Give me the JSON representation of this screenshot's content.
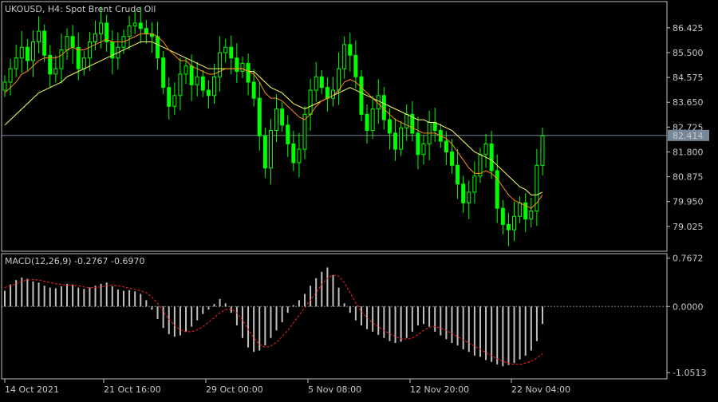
{
  "chart_data": {
    "type": "candlestick",
    "title": "UKOUSD, H4:  Spot Brent Crude Oil",
    "price_panel": {
      "ylim": [
        78.1,
        87.4
      ],
      "yticks": [
        "86.425",
        "85.500",
        "84.575",
        "83.650",
        "82.725",
        "81.800",
        "80.875",
        "79.950",
        "79.025"
      ],
      "current_price": "82.414",
      "series": {
        "close": [
          84.4,
          84.9,
          85.3,
          85.7,
          85.2,
          85.9,
          86.3,
          85.4,
          84.7,
          84.9,
          85.6,
          86.1,
          85.7,
          84.9,
          85.3,
          85.9,
          86.2,
          86.6,
          85.9,
          85.3,
          85.7,
          86.1,
          86.5,
          86.6,
          86.4,
          86.2,
          86.1,
          85.3,
          84.2,
          83.5,
          83.9,
          84.7,
          85.0,
          84.3,
          84.6,
          84.1,
          83.9,
          84.6,
          85.5,
          85.7,
          85.3,
          84.8,
          85.1,
          84.4,
          83.8,
          82.4,
          81.2,
          82.6,
          83.4,
          82.8,
          82.1,
          81.4,
          81.9,
          83.2,
          84.1,
          84.6,
          84.2,
          83.8,
          84.1,
          84.9,
          85.8,
          85.4,
          84.6,
          83.2,
          82.6,
          83.4,
          83.9,
          83.0,
          82.5,
          81.9,
          82.7,
          83.2,
          82.5,
          81.7,
          82.1,
          82.9,
          82.6,
          82.2,
          81.8,
          81.3,
          80.6,
          79.9,
          80.3,
          80.9,
          81.7,
          82.1,
          81.1,
          79.7,
          79.1,
          78.9,
          79.4,
          79.9,
          79.3,
          79.6,
          81.3,
          82.4
        ],
        "ema_fast": [
          84.0,
          84.2,
          84.4,
          84.7,
          84.8,
          85.0,
          85.2,
          85.3,
          85.3,
          85.3,
          85.4,
          85.6,
          85.7,
          85.6,
          85.6,
          85.7,
          85.8,
          85.9,
          86.0,
          85.9,
          85.9,
          85.9,
          86.0,
          86.1,
          86.2,
          86.2,
          86.2,
          86.1,
          85.9,
          85.6,
          85.4,
          85.2,
          85.2,
          85.0,
          84.9,
          84.8,
          84.7,
          84.7,
          84.8,
          84.9,
          84.9,
          84.9,
          84.9,
          84.8,
          84.7,
          84.4,
          84.0,
          83.8,
          83.8,
          83.7,
          83.5,
          83.3,
          83.1,
          83.0,
          83.2,
          83.5,
          83.7,
          83.8,
          83.9,
          84.1,
          84.4,
          84.5,
          84.4,
          84.2,
          84.0,
          83.8,
          83.6,
          83.4,
          83.2,
          83.0,
          82.9,
          82.8,
          82.7,
          82.6,
          82.5,
          82.5,
          82.5,
          82.4,
          82.3,
          82.1,
          81.8,
          81.5,
          81.2,
          81.0,
          81.0,
          81.1,
          81.0,
          80.8,
          80.5,
          80.2,
          80.0,
          79.9,
          79.8,
          79.7,
          79.9,
          80.2
        ],
        "ema_slow": [
          82.8,
          83.0,
          83.2,
          83.4,
          83.6,
          83.8,
          84.0,
          84.1,
          84.2,
          84.3,
          84.4,
          84.6,
          84.7,
          84.8,
          84.9,
          85.0,
          85.1,
          85.2,
          85.3,
          85.4,
          85.5,
          85.6,
          85.7,
          85.8,
          85.9,
          85.9,
          85.9,
          85.8,
          85.7,
          85.6,
          85.5,
          85.4,
          85.3,
          85.2,
          85.1,
          85.0,
          84.9,
          84.9,
          84.9,
          84.9,
          84.9,
          84.9,
          84.9,
          84.8,
          84.8,
          84.6,
          84.4,
          84.2,
          84.1,
          84.0,
          83.8,
          83.6,
          83.5,
          83.4,
          83.5,
          83.6,
          83.7,
          83.8,
          83.9,
          84.0,
          84.1,
          84.2,
          84.1,
          84.0,
          83.9,
          83.8,
          83.7,
          83.6,
          83.5,
          83.4,
          83.3,
          83.2,
          83.1,
          83.0,
          83.0,
          82.9,
          82.9,
          82.8,
          82.7,
          82.6,
          82.4,
          82.2,
          82.0,
          81.8,
          81.7,
          81.6,
          81.5,
          81.3,
          81.1,
          80.9,
          80.7,
          80.5,
          80.4,
          80.2,
          80.2,
          80.3
        ]
      }
    },
    "macd_panel": {
      "label": "MACD(12,26,9) -0.2767 -0.6970",
      "ylim": [
        -1.15,
        0.84
      ],
      "yticks": [
        "0.7672",
        "0.0000",
        "-1.0513"
      ],
      "histogram": [
        0.25,
        0.35,
        0.42,
        0.46,
        0.44,
        0.4,
        0.38,
        0.33,
        0.3,
        0.29,
        0.32,
        0.36,
        0.35,
        0.3,
        0.28,
        0.3,
        0.33,
        0.36,
        0.38,
        0.32,
        0.27,
        0.25,
        0.26,
        0.24,
        0.2,
        0.1,
        -0.05,
        -0.2,
        -0.34,
        -0.44,
        -0.48,
        -0.46,
        -0.4,
        -0.32,
        -0.22,
        -0.12,
        -0.05,
        0.04,
        0.12,
        0.05,
        -0.1,
        -0.3,
        -0.5,
        -0.65,
        -0.72,
        -0.7,
        -0.62,
        -0.5,
        -0.38,
        -0.25,
        -0.1,
        0.02,
        0.1,
        0.2,
        0.33,
        0.45,
        0.55,
        0.62,
        0.5,
        0.3,
        0.05,
        -0.1,
        -0.22,
        -0.3,
        -0.36,
        -0.4,
        -0.45,
        -0.5,
        -0.55,
        -0.58,
        -0.56,
        -0.5,
        -0.4,
        -0.3,
        -0.28,
        -0.32,
        -0.4,
        -0.46,
        -0.52,
        -0.58,
        -0.62,
        -0.68,
        -0.72,
        -0.78,
        -0.8,
        -0.85,
        -0.88,
        -0.92,
        -0.95,
        -0.93,
        -0.9,
        -0.84,
        -0.78,
        -0.7,
        -0.55,
        -0.28
      ],
      "signal": [
        0.3,
        0.33,
        0.36,
        0.4,
        0.42,
        0.43,
        0.42,
        0.4,
        0.38,
        0.36,
        0.35,
        0.34,
        0.34,
        0.33,
        0.31,
        0.3,
        0.3,
        0.31,
        0.33,
        0.34,
        0.33,
        0.31,
        0.29,
        0.27,
        0.25,
        0.22,
        0.15,
        0.05,
        -0.08,
        -0.2,
        -0.3,
        -0.37,
        -0.4,
        -0.4,
        -0.37,
        -0.32,
        -0.25,
        -0.18,
        -0.1,
        -0.05,
        -0.04,
        -0.1,
        -0.22,
        -0.36,
        -0.5,
        -0.6,
        -0.65,
        -0.63,
        -0.57,
        -0.48,
        -0.38,
        -0.26,
        -0.14,
        -0.02,
        0.1,
        0.22,
        0.35,
        0.45,
        0.5,
        0.48,
        0.38,
        0.22,
        0.06,
        -0.08,
        -0.18,
        -0.26,
        -0.32,
        -0.38,
        -0.43,
        -0.48,
        -0.51,
        -0.52,
        -0.5,
        -0.45,
        -0.38,
        -0.33,
        -0.32,
        -0.34,
        -0.38,
        -0.43,
        -0.48,
        -0.53,
        -0.58,
        -0.63,
        -0.68,
        -0.73,
        -0.78,
        -0.83,
        -0.87,
        -0.9,
        -0.92,
        -0.92,
        -0.9,
        -0.87,
        -0.82,
        -0.75
      ]
    },
    "x_labels": [
      "14 Oct 2021",
      "21 Oct 16:00",
      "29 Oct 00:00",
      "5 Nov 08:00",
      "12 Nov 20:00",
      "22 Nov 04:00"
    ],
    "x_label_bar_index": [
      0,
      21,
      42,
      63,
      84,
      105
    ],
    "colors": {
      "background": "#000000",
      "bullish_candle": "#00ff00",
      "ema_fast": "#ff8c1a",
      "ema_slow": "#ffff66",
      "macd_histogram": "#c0c0c0",
      "macd_signal": "#ff2020",
      "grid_frame": "#c0c0c0",
      "price_line": "#778899",
      "price_tag": "#778899"
    }
  }
}
